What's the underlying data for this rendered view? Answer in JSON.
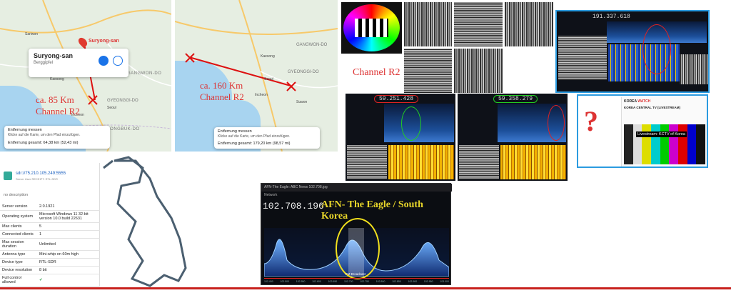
{
  "map1": {
    "place_name": "Suryong-san",
    "place_type": "Berggipfel",
    "marker_label": "Suryong-san",
    "regions": [
      "GANGWON-DO",
      "GYEONGGI-DO",
      "CHEONGBUK-DO"
    ],
    "cities": [
      "Sariwon",
      "Kaesong",
      "Seoul",
      "Incheon"
    ],
    "annotation_distance": "ca. 85 Km",
    "annotation_channel": "Channel R2",
    "measure": {
      "title": "Entfernung messen",
      "hint": "Klicke auf die Karte, um den Pfad einzufügen.",
      "total": "Entfernung gesamt: 64,38 km (52,43 mi)"
    }
  },
  "map2": {
    "cities": [
      "Kaesong",
      "Seoul",
      "Incheon",
      "Suwon"
    ],
    "regions": [
      "GYEONGGI-DO",
      "GANGWON-DO"
    ],
    "annotation_distance": "ca. 160 Km",
    "annotation_channel": "Channel R2",
    "measure": {
      "title": "Entfernung messen",
      "hint": "Klicke auf die Karte, um den Pfad einzufügen.",
      "total": "Entfernung gesamt: 179,20 km (98,57 mi)"
    }
  },
  "channel_label": "Channel R2",
  "sdr_mid": {
    "freq_left": "59.251.428",
    "freq_right": "59.358.279"
  },
  "sdr_top_right": {
    "freq": "191.337.618"
  },
  "question_mark": "?",
  "korea_web": {
    "brand": "KOREA",
    "brand2": "WATCH",
    "headline": "KOREA CENTRAL TV (LIVESTREAM)",
    "test_text": "Livestream: KCTV of Korea"
  },
  "server_info": {
    "address": "sdr://75.210.105.249:5555",
    "sub": "Server User RECEIPT: RTL-SDR",
    "description": "no description",
    "rows": [
      {
        "label": "Server version",
        "value": "2.0.1921"
      },
      {
        "label": "Operating system",
        "value": "Microsoft Windows 11 32-bit version 10.0 build 22631"
      },
      {
        "label": "Max clients",
        "value": "5"
      },
      {
        "label": "Connected clients",
        "value": "1"
      },
      {
        "label": "Max session duration",
        "value": "Unlimited"
      },
      {
        "label": "Antenna type",
        "value": "Mini-whip on 60m high"
      },
      {
        "label": "Device type",
        "value": "RTL-SDR"
      },
      {
        "label": "Device resolution",
        "value": "8 bit"
      },
      {
        "label": "Full control allowed",
        "value": "✔"
      }
    ]
  },
  "afn": {
    "window_title": "AFN-The Eagle: ABC News 102.708.jpg",
    "network_label": "Network",
    "frequency": "102.708.196",
    "caption": "AFN- The Eagle / South Korea",
    "broadcast_label": "FM Broadcast",
    "axis_ticks": [
      "102.450",
      "102.500",
      "102.550",
      "102.600",
      "102.650",
      "102.700",
      "102.750",
      "102.800",
      "102.850",
      "102.900",
      "102.950",
      "103.000"
    ]
  }
}
